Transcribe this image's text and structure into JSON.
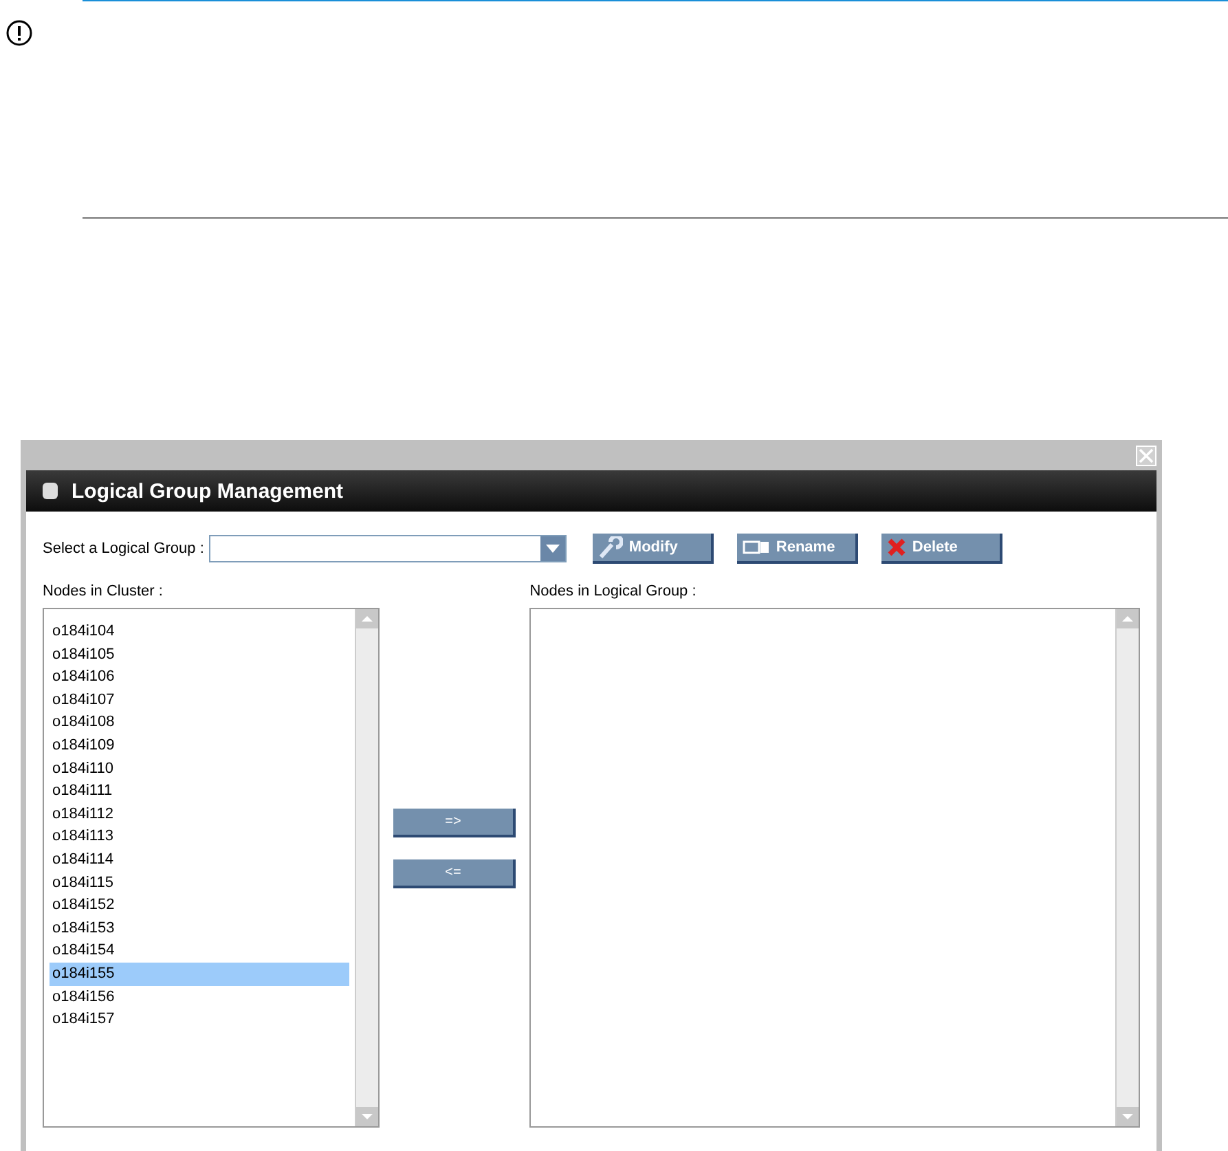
{
  "dialog": {
    "title": "Logical Group Management",
    "select_label": "Select a Logical Group :",
    "actions": [
      {
        "label": "Modify",
        "kind": "modify"
      },
      {
        "label": "Rename",
        "kind": "rename"
      },
      {
        "label": "Delete",
        "kind": "delete"
      }
    ],
    "cluster_list": {
      "label": "Nodes in Cluster :",
      "items": [
        {
          "label": "o184i104",
          "selected": false
        },
        {
          "label": "o184i105",
          "selected": false
        },
        {
          "label": "o184i106",
          "selected": false
        },
        {
          "label": "o184i107",
          "selected": false
        },
        {
          "label": "o184i108",
          "selected": false
        },
        {
          "label": "o184i109",
          "selected": false
        },
        {
          "label": "o184i110",
          "selected": false
        },
        {
          "label": "o184i111",
          "selected": false
        },
        {
          "label": "o184i112",
          "selected": false
        },
        {
          "label": "o184i113",
          "selected": false
        },
        {
          "label": "o184i114",
          "selected": false
        },
        {
          "label": "o184i115",
          "selected": false
        },
        {
          "label": "o184i152",
          "selected": false
        },
        {
          "label": "o184i153",
          "selected": false
        },
        {
          "label": "o184i154",
          "selected": false
        },
        {
          "label": "o184i155",
          "selected": true
        },
        {
          "label": "o184i156",
          "selected": false
        },
        {
          "label": "o184i157",
          "selected": false
        }
      ]
    },
    "transfer_buttons": [
      "=>",
      "<="
    ],
    "group_list": {
      "label": "Nodes in Logical Group :"
    }
  }
}
